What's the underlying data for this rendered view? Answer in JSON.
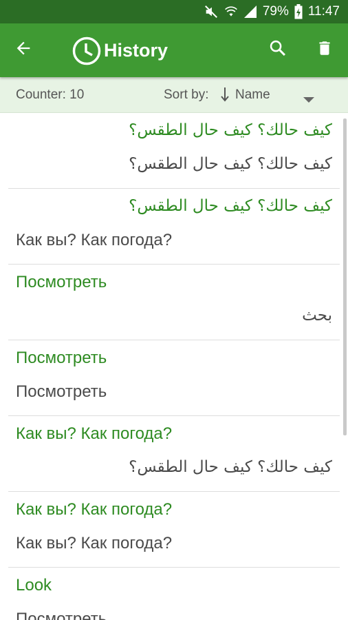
{
  "status_bar": {
    "battery": "79%",
    "time": "11:47"
  },
  "toolbar": {
    "title": "History",
    "back_icon": "back-arrow-icon",
    "history_icon": "clock-icon",
    "search_icon": "search-icon",
    "delete_icon": "trash-icon"
  },
  "sort_bar": {
    "counter": "Counter: 10",
    "sort_label": "Sort by:",
    "sort_value": "Name"
  },
  "items": [
    {
      "source": "كيف حالك؟ كيف حال الطقس؟",
      "target": "كيف حالك؟ كيف حال الطقس؟",
      "source_dir": "rtl",
      "target_dir": "rtl"
    },
    {
      "source": "كيف حالك؟ كيف حال الطقس؟",
      "target": "Как вы? Как погода?",
      "source_dir": "rtl",
      "target_dir": "ltr"
    },
    {
      "source": "Посмотреть",
      "target": "بحث",
      "source_dir": "ltr",
      "target_dir": "rtl"
    },
    {
      "source": "Посмотреть",
      "target": "Посмотреть",
      "source_dir": "ltr",
      "target_dir": "ltr"
    },
    {
      "source": "Как вы? Как погода?",
      "target": "كيف حالك؟ كيف حال الطقس؟",
      "source_dir": "ltr",
      "target_dir": "rtl"
    },
    {
      "source": "Как вы? Как погода?",
      "target": "Как вы? Как погода?",
      "source_dir": "ltr",
      "target_dir": "ltr"
    },
    {
      "source": "Look",
      "target": "Посмотреть",
      "source_dir": "ltr",
      "target_dir": "ltr"
    }
  ],
  "colors": {
    "toolbar": "#3f9a33",
    "status_bar": "#2b6d25",
    "sort_bar": "#e7f3e4",
    "source_text": "#2e8b22",
    "target_text": "#4a4a4a"
  }
}
